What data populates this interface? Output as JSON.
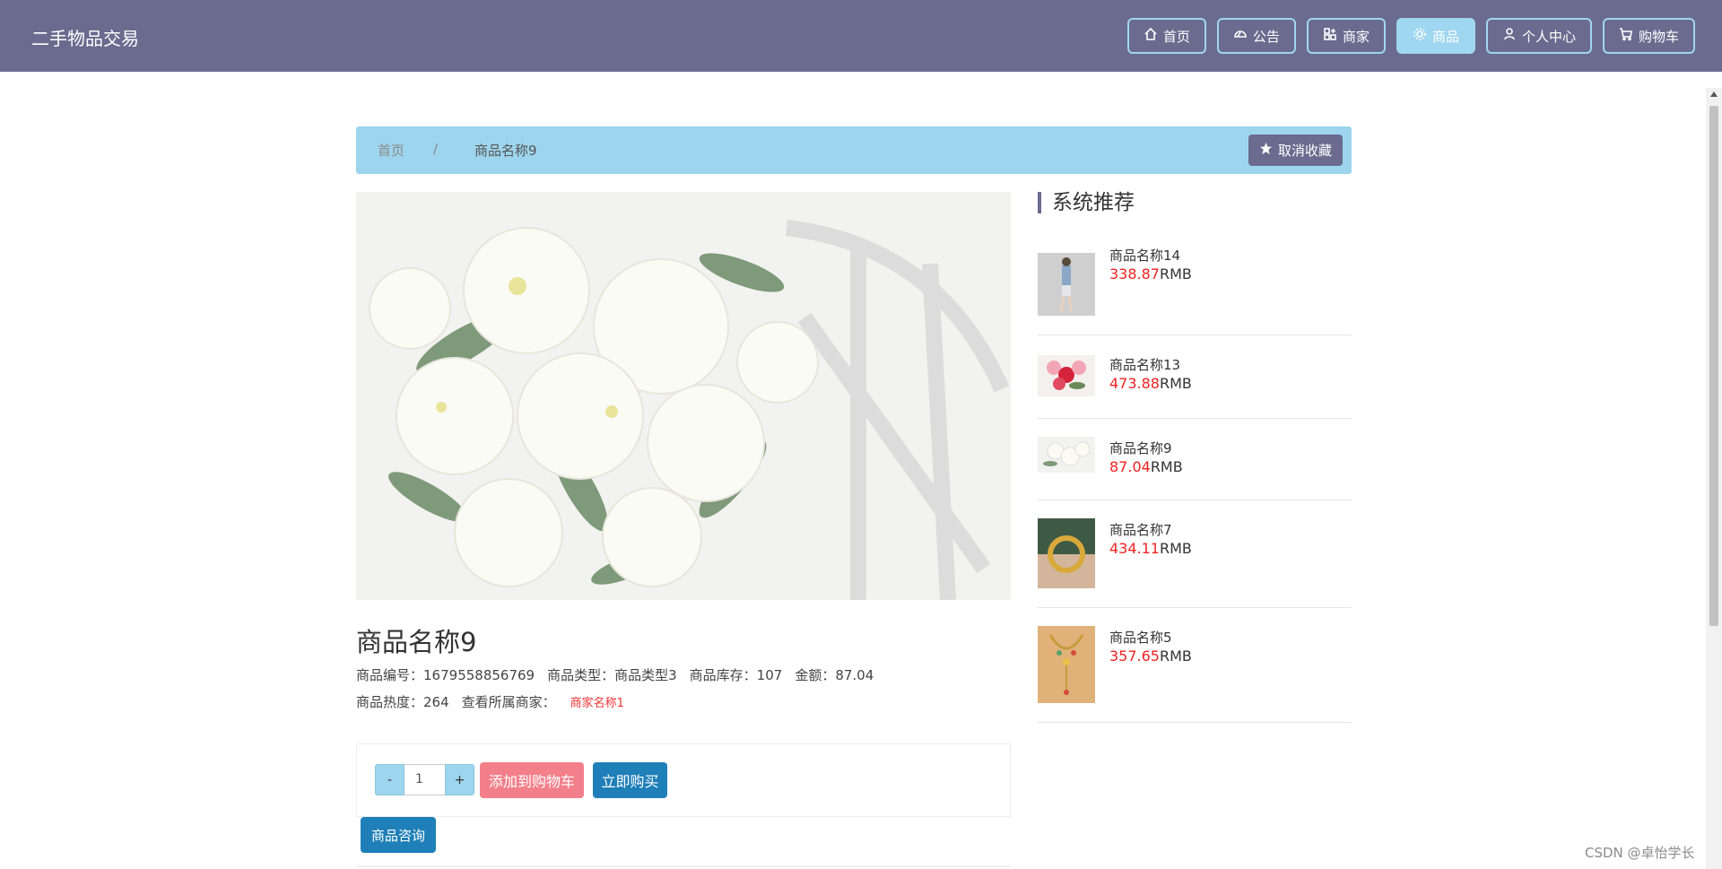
{
  "header": {
    "brand": "二手物品交易",
    "nav": [
      {
        "label": "首页",
        "icon": "home-icon",
        "active": false
      },
      {
        "label": "公告",
        "icon": "announcement-icon",
        "active": false
      },
      {
        "label": "商家",
        "icon": "grid-icon",
        "active": false
      },
      {
        "label": "商品",
        "icon": "goods-icon",
        "active": true
      },
      {
        "label": "个人中心",
        "icon": "user-icon",
        "active": false
      },
      {
        "label": "购物车",
        "icon": "cart-icon",
        "active": false
      }
    ]
  },
  "breadcrumb": {
    "home": "首页",
    "separator": "/",
    "current": "商品名称9",
    "unfavorite_label": "取消收藏"
  },
  "product": {
    "title": "商品名称9",
    "code_label": "商品编号：",
    "code": "1679558856769",
    "type_label": "商品类型：",
    "type": "商品类型3",
    "stock_label": "商品库存：",
    "stock": "107",
    "price_label": "金额：",
    "price": "87.04",
    "heat_label": "商品热度：",
    "heat": "264",
    "merchant_label": "查看所属商家：",
    "merchant": "商家名称1"
  },
  "purchase": {
    "minus": "-",
    "quantity": "1",
    "plus": "+",
    "add_to_cart": "添加到购物车",
    "buy_now": "立即购买",
    "consult": "商品咨询"
  },
  "recommend": {
    "title": "系统推荐",
    "unit": "RMB",
    "items": [
      {
        "name": "商品名称14",
        "price": "338.87"
      },
      {
        "name": "商品名称13",
        "price": "473.88"
      },
      {
        "name": "商品名称9",
        "price": "87.04"
      },
      {
        "name": "商品名称7",
        "price": "434.11"
      },
      {
        "name": "商品名称5",
        "price": "357.65"
      }
    ]
  },
  "watermark": "CSDN @卓怡学长",
  "colors": {
    "header_bg": "#6b6b8f",
    "accent_light": "#9dd5ee",
    "primary_blue": "#1f7fb8",
    "cart_pink": "#f27f8a",
    "price_red": "#e22"
  }
}
